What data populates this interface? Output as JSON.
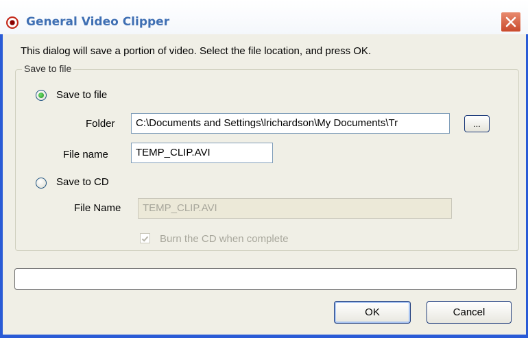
{
  "window": {
    "title": "General Video Clipper",
    "title_icon": "eye-icon",
    "close_icon": "close-icon"
  },
  "intro_text": "This dialog will save a portion of video.  Select the file location, and press OK.",
  "group": {
    "title": "Save to file",
    "save_to_file": {
      "label": "Save to file",
      "selected": true,
      "folder_label": "Folder",
      "folder_value": "C:\\Documents and Settings\\lrichardson\\My Documents\\Tr",
      "browse_label": "...",
      "filename_label": "File name",
      "filename_value": "TEMP_CLIP.AVI"
    },
    "save_to_cd": {
      "label": "Save to CD",
      "selected": false,
      "filename_label": "File Name",
      "filename_value": "TEMP_CLIP.AVI",
      "burn_label": "Burn the CD when complete",
      "burn_checked": true
    }
  },
  "progress": {
    "value": 0
  },
  "buttons": {
    "ok": "OK",
    "cancel": "Cancel"
  }
}
